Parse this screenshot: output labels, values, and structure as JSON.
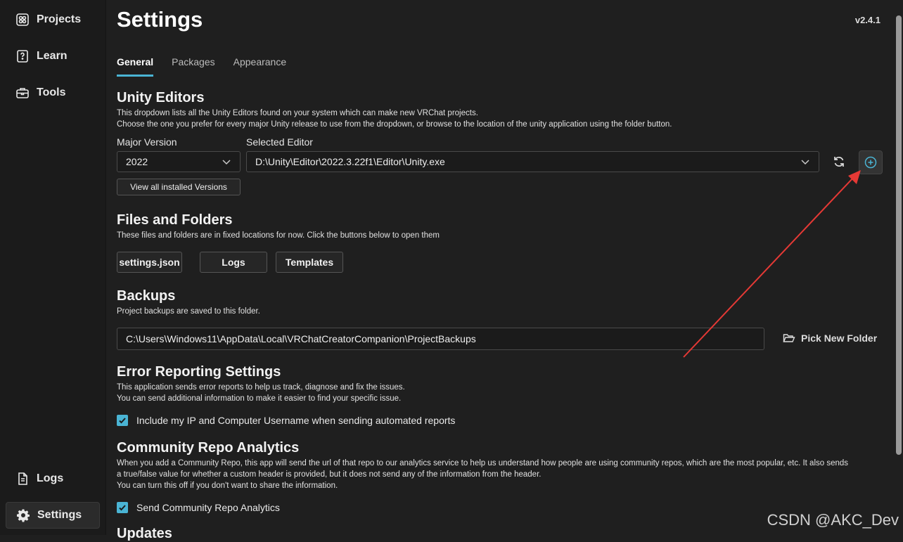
{
  "sidebar": {
    "items": [
      {
        "label": "Projects",
        "icon": "grid-icon"
      },
      {
        "label": "Learn",
        "icon": "help-book-icon"
      },
      {
        "label": "Tools",
        "icon": "toolbox-icon"
      }
    ],
    "bottom": [
      {
        "label": "Logs",
        "icon": "document-icon"
      },
      {
        "label": "Settings",
        "icon": "gear-icon",
        "active": true
      }
    ]
  },
  "header": {
    "title": "Settings",
    "version": "v2.4.1"
  },
  "tabs": [
    "General",
    "Packages",
    "Appearance"
  ],
  "unity_editors": {
    "title": "Unity Editors",
    "desc1": "This dropdown lists all the Unity Editors found on your system which can make new VRChat projects.",
    "desc2": "Choose the one you prefer for every major Unity release to use from the dropdown, or browse to the location of the unity application using the folder button.",
    "major_label": "Major Version",
    "major_value": "2022",
    "editor_label": "Selected Editor",
    "editor_value": "D:\\Unity\\Editor\\2022.3.22f1\\Editor\\Unity.exe",
    "view_all": "View all installed Versions"
  },
  "files": {
    "title": "Files and Folders",
    "desc": "These files and folders are in fixed locations for now. Click the buttons below to open them",
    "buttons": [
      "settings.json",
      "Logs",
      "Templates"
    ]
  },
  "backups": {
    "title": "Backups",
    "desc": "Project backups are saved to this folder.",
    "path": "C:\\Users\\Windows11\\AppData\\Local\\VRChatCreatorCompanion\\ProjectBackups",
    "pick": "Pick New Folder"
  },
  "error_reporting": {
    "title": "Error Reporting Settings",
    "desc1": "This application sends error reports to help us track, diagnose and fix the issues.",
    "desc2": "You can send additional information to make it easier to find your specific issue.",
    "check_label": "Include my IP and Computer Username when sending automated reports",
    "checked": true
  },
  "community": {
    "title": "Community Repo Analytics",
    "desc1": "When you add a Community Repo, this app will send the url of that repo to our analytics service to help us understand how people are using community repos, which are the most popular, etc. It also sends",
    "desc2": "a true/false value for whether a custom header is provided, but it does not send any of the information from the header.",
    "desc3": "You can turn this off if you don't want to share the information.",
    "check_label": "Send Community Repo Analytics",
    "checked": true
  },
  "updates": {
    "title": "Updates"
  },
  "watermark": "CSDN @AKC_Dev",
  "colors": {
    "accent": "#4ab4d4",
    "annotation_arrow": "#e53935"
  }
}
